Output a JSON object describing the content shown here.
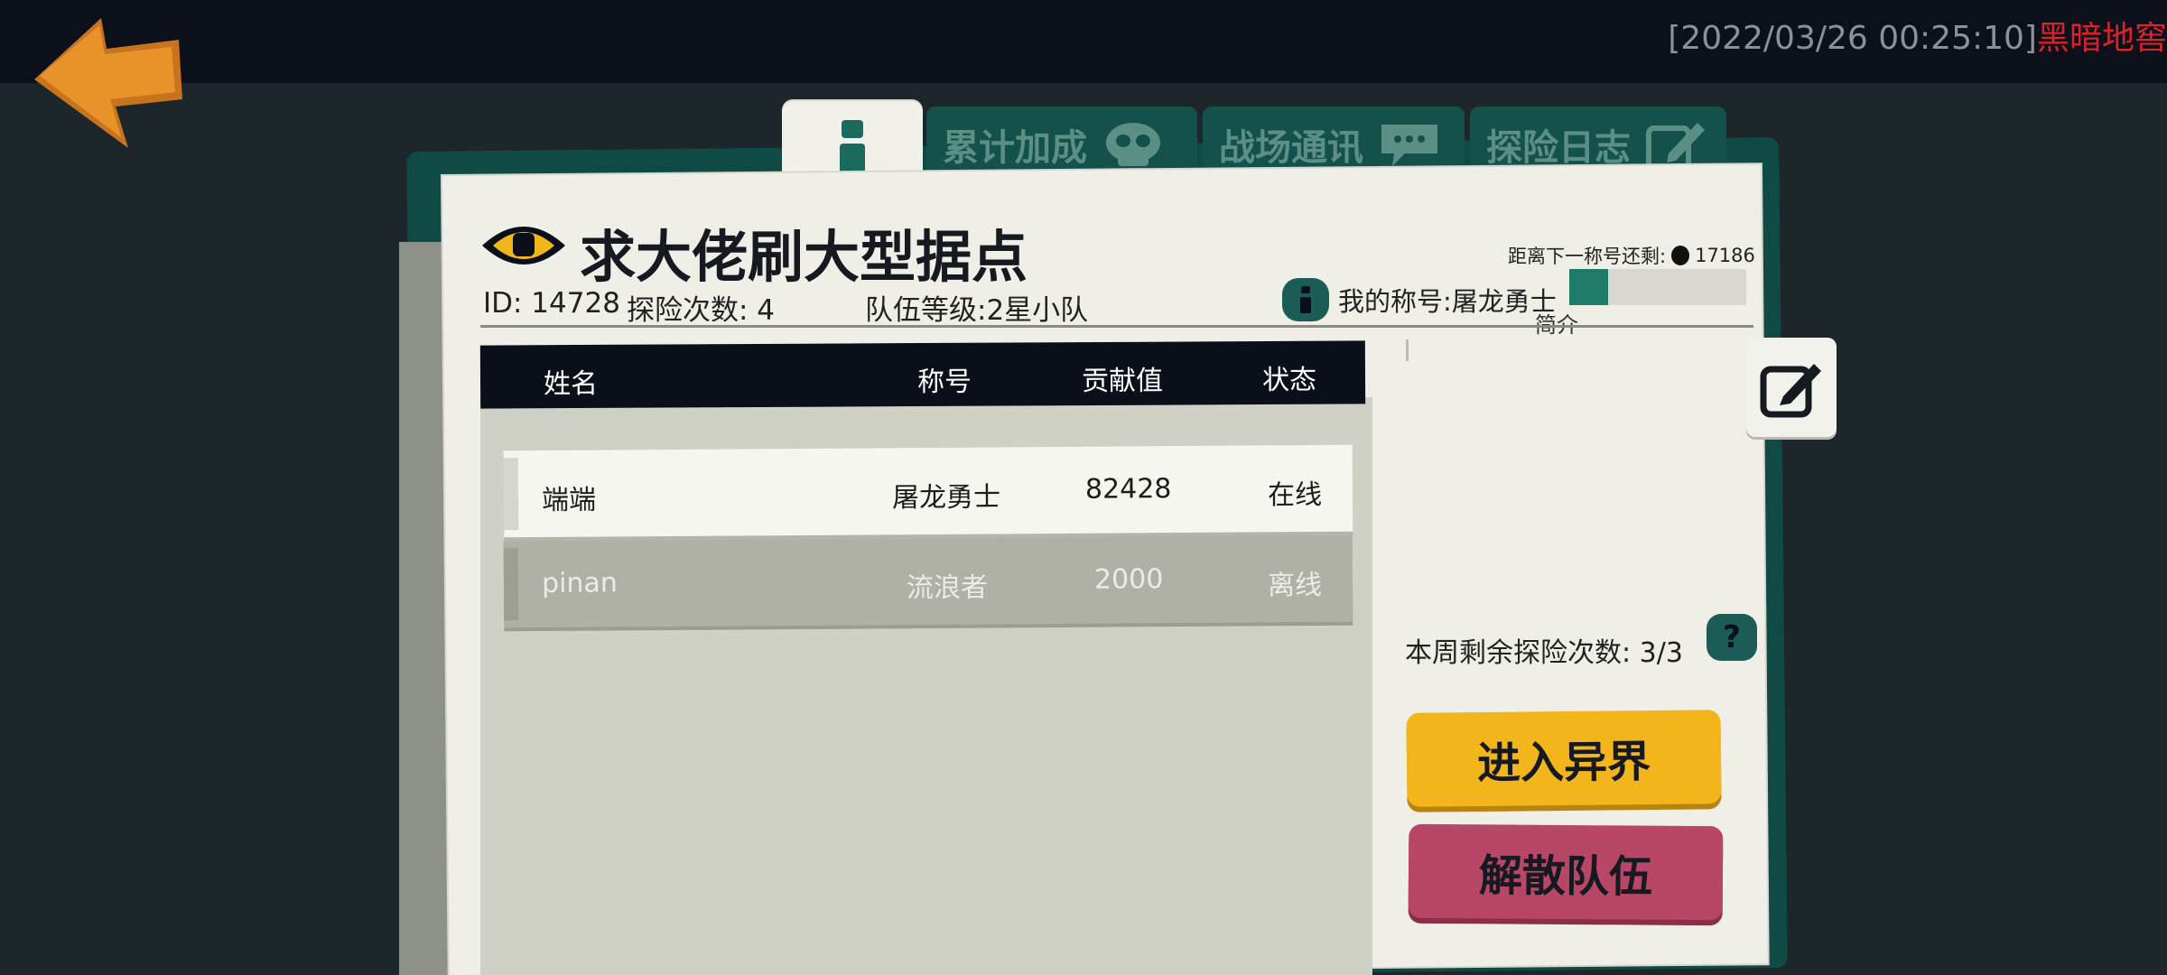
{
  "header": {
    "timestamp": "[2022/03/26 00:25:10]",
    "location": "黑暗地窖"
  },
  "tabs": [
    {
      "label": "累计加成",
      "icon": "skull-icon"
    },
    {
      "label": "战场通讯",
      "icon": "chat-bubble-icon"
    },
    {
      "label": "探险日志",
      "icon": "pencil-edit-icon"
    }
  ],
  "team": {
    "name": "求大佬刷大型据点",
    "id_label": "ID: 14728",
    "expeditions_label": "探险次数:  4",
    "level_label": "队伍等级:2星小队",
    "next_title_label": "距离下一称号还剩:",
    "next_title_value": "17186",
    "my_title_label": "我的称号:屠龙勇士",
    "title_progress": 0.22,
    "intro_label": "简介"
  },
  "table": {
    "headers": [
      "姓名",
      "称号",
      "贡献值",
      "状态"
    ],
    "rows": [
      {
        "name": "端端",
        "title": "屠龙勇士",
        "contribution": "82428",
        "status": "在线"
      },
      {
        "name": "pinan",
        "title": "流浪者",
        "contribution": "2000",
        "status": "离线"
      }
    ]
  },
  "side": {
    "weekly_label": "本周剩余探险次数:  3/3",
    "help_label": "?",
    "enter_button": "进入异界",
    "disband_button": "解散队伍"
  },
  "colors": {
    "teal": "#14514b",
    "accent_yellow": "#f2b61c",
    "accent_red": "#b84767",
    "orange_back": "#e8922a"
  }
}
